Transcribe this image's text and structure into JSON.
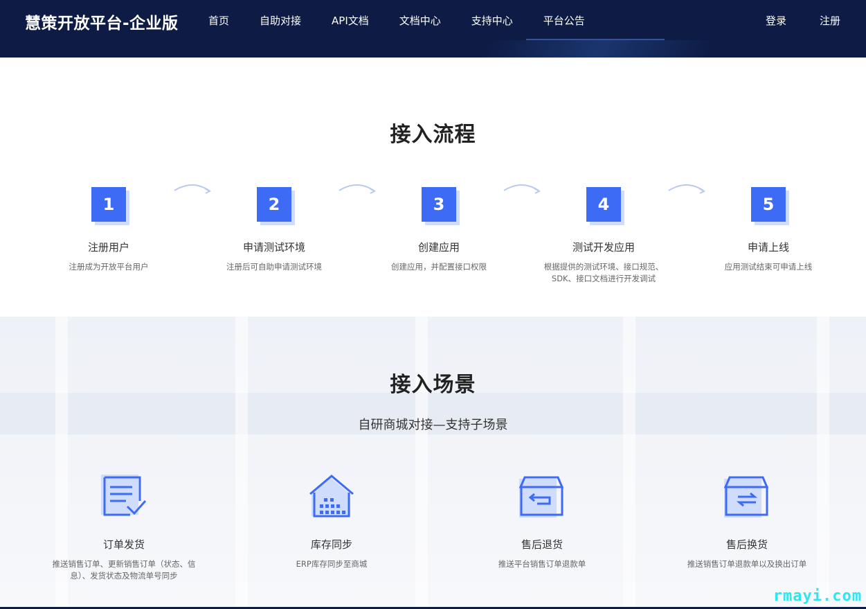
{
  "header": {
    "brand": "慧策开放平台-企业版",
    "nav": [
      "首页",
      "自助对接",
      "API文档",
      "文档中心",
      "支持中心",
      "平台公告"
    ],
    "login": "登录",
    "register": "注册"
  },
  "process": {
    "title": "接入流程",
    "steps": [
      {
        "num": "1",
        "label": "注册用户",
        "desc": "注册成为开放平台用户"
      },
      {
        "num": "2",
        "label": "申请测试环境",
        "desc": "注册后可自助申请测试环境"
      },
      {
        "num": "3",
        "label": "创建应用",
        "desc": "创建应用，并配置接口权限"
      },
      {
        "num": "4",
        "label": "测试开发应用",
        "desc": "根据提供的测试环境、接口规范、SDK、接口文档进行开发调试"
      },
      {
        "num": "5",
        "label": "申请上线",
        "desc": "应用测试结束可申请上线"
      }
    ]
  },
  "scenes": {
    "title": "接入场景",
    "subtitle": "自研商城对接—支持子场景",
    "items": [
      {
        "icon": "order-document-icon",
        "label": "订单发货",
        "desc": "推送销售订单、更新销售订单（状态、信息）、发货状态及物流单号同步"
      },
      {
        "icon": "warehouse-icon",
        "label": "库存同步",
        "desc": "ERP库存同步至商城"
      },
      {
        "icon": "return-box-icon",
        "label": "售后退货",
        "desc": "推送平台销售订单退款单"
      },
      {
        "icon": "exchange-box-icon",
        "label": "售后换货",
        "desc": "推送销售订单退款单以及换出订单"
      }
    ]
  },
  "watermark": "rmayi.com",
  "colors": {
    "header_bg": "#0e1c45",
    "accent": "#3e6bf5",
    "accent_light": "#cfdcfb"
  }
}
